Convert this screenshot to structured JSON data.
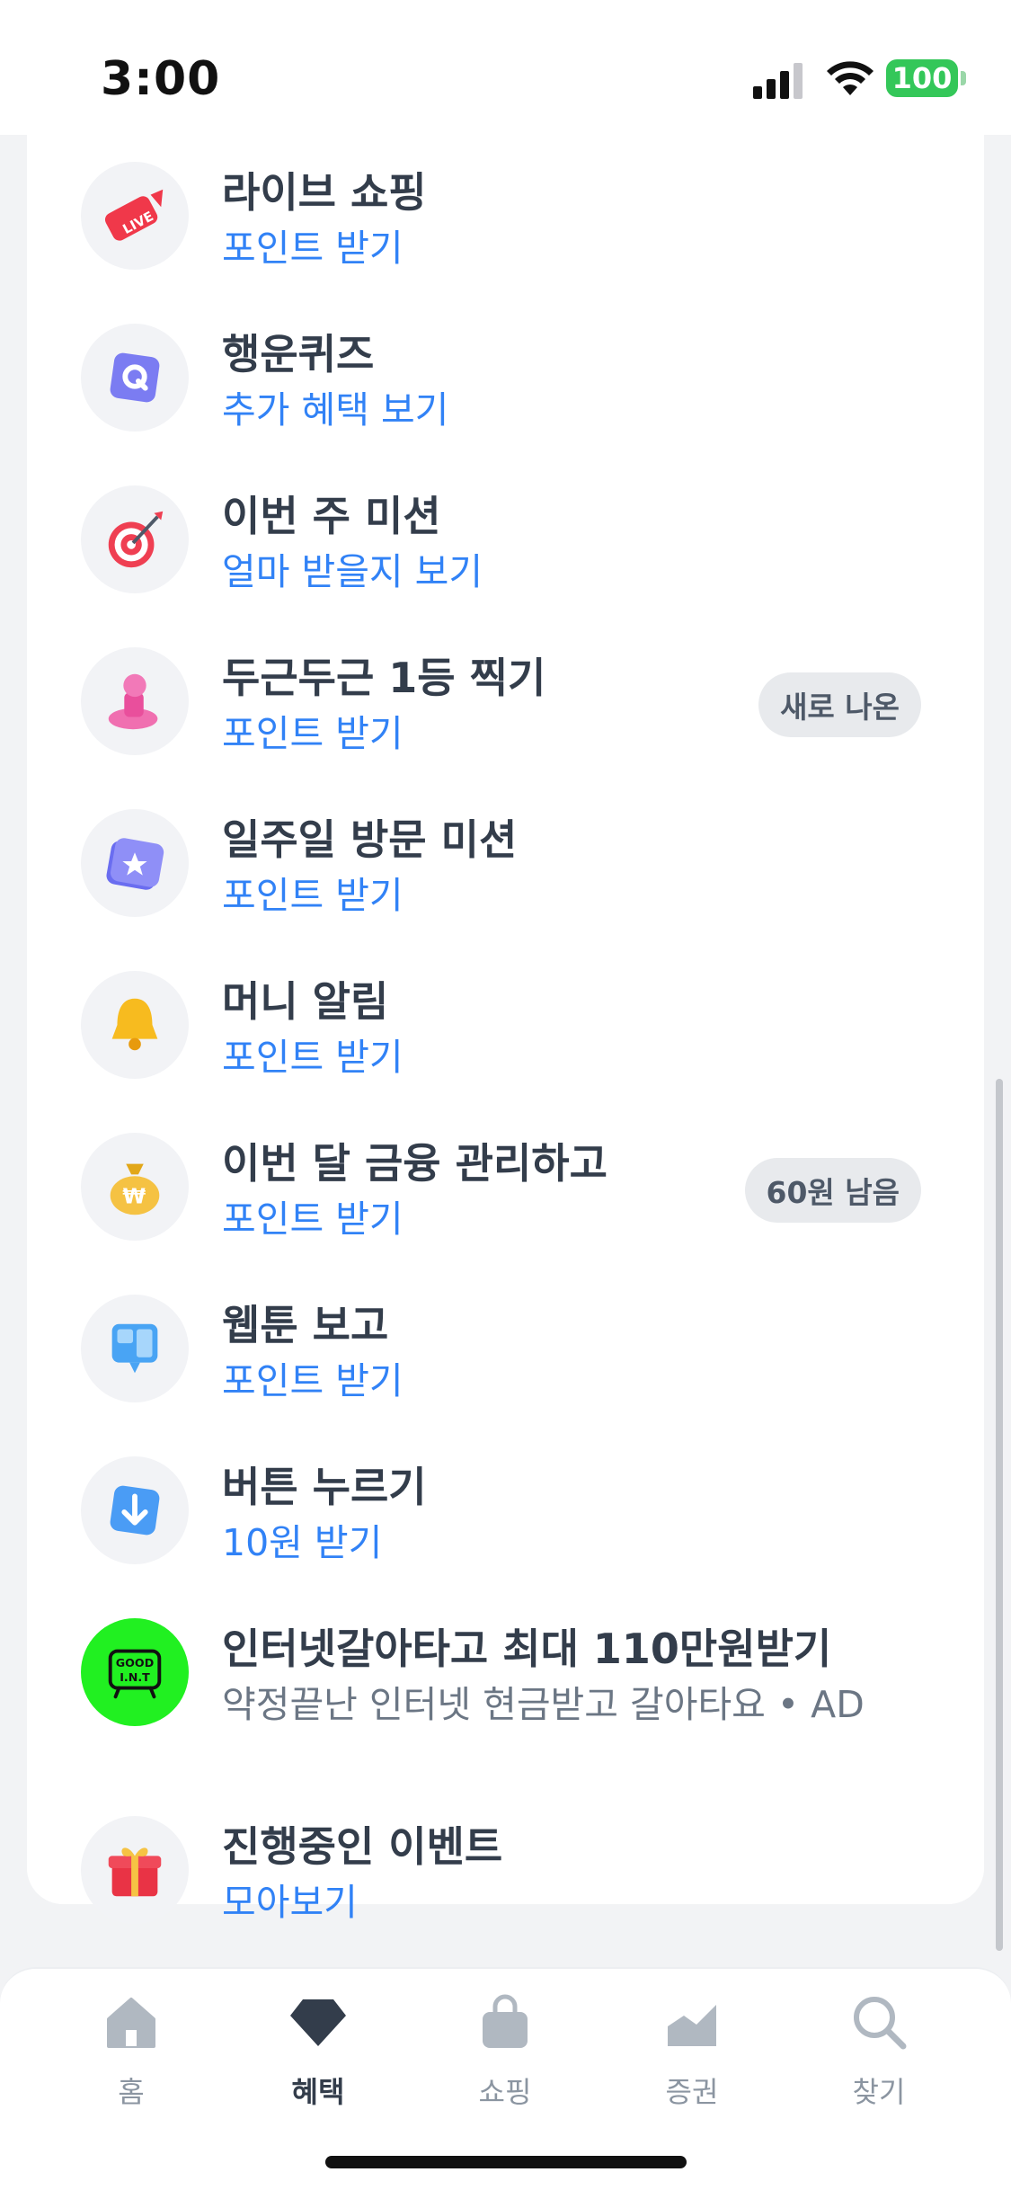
{
  "status_bar": {
    "time": "3:00",
    "battery": "100"
  },
  "colors": {
    "accent": "#3182f6",
    "title": "#333d4b",
    "battery_green": "#34c759"
  },
  "items": [
    {
      "icon": "live-shopping-icon",
      "title": "라이브 쇼핑",
      "subtitle": "포인트 받기",
      "badge": ""
    },
    {
      "icon": "quiz-icon",
      "title": "행운퀴즈",
      "subtitle": "추가 혜택 보기",
      "badge": ""
    },
    {
      "icon": "target-icon",
      "title": "이번 주 미션",
      "subtitle": "얼마 받을지 보기",
      "badge": ""
    },
    {
      "icon": "stamp-icon",
      "title": "두근두근 1등 찍기",
      "subtitle": "포인트 받기",
      "badge": "새로 나온"
    },
    {
      "icon": "calendar-icon",
      "title": "일주일 방문 미션",
      "subtitle": "포인트 받기",
      "badge": ""
    },
    {
      "icon": "bell-icon",
      "title": "머니 알림",
      "subtitle": "포인트 받기",
      "badge": ""
    },
    {
      "icon": "money-bag-icon",
      "title": "이번 달 금융 관리하고",
      "subtitle": "포인트 받기",
      "badge": "60원 남음"
    },
    {
      "icon": "webtoon-icon",
      "title": "웹툰 보고",
      "subtitle": "포인트 받기",
      "badge": ""
    },
    {
      "icon": "down-arrow-button-icon",
      "title": "버튼 누르기",
      "subtitle": "10원 받기",
      "badge": ""
    },
    {
      "icon": "good-int-logo",
      "logo_text": "GOOD I.N.T",
      "title": "인터넷갈아타고 최대 110만원받기",
      "subtitle": "약정끝난 인터넷 현금받고 갈아타요 • AD",
      "badge": ""
    },
    {
      "icon": "gift-icon",
      "title": "진행중인 이벤트",
      "subtitle": "모아보기",
      "badge": ""
    }
  ],
  "tabs": [
    {
      "icon": "home-icon",
      "label": "홈",
      "active": false
    },
    {
      "icon": "benefits-gem-icon",
      "label": "혜택",
      "active": true
    },
    {
      "icon": "shopping-bag-icon",
      "label": "쇼핑",
      "active": false
    },
    {
      "icon": "stocks-chart-icon",
      "label": "증권",
      "active": false
    },
    {
      "icon": "search-icon",
      "label": "찾기",
      "active": false
    }
  ]
}
